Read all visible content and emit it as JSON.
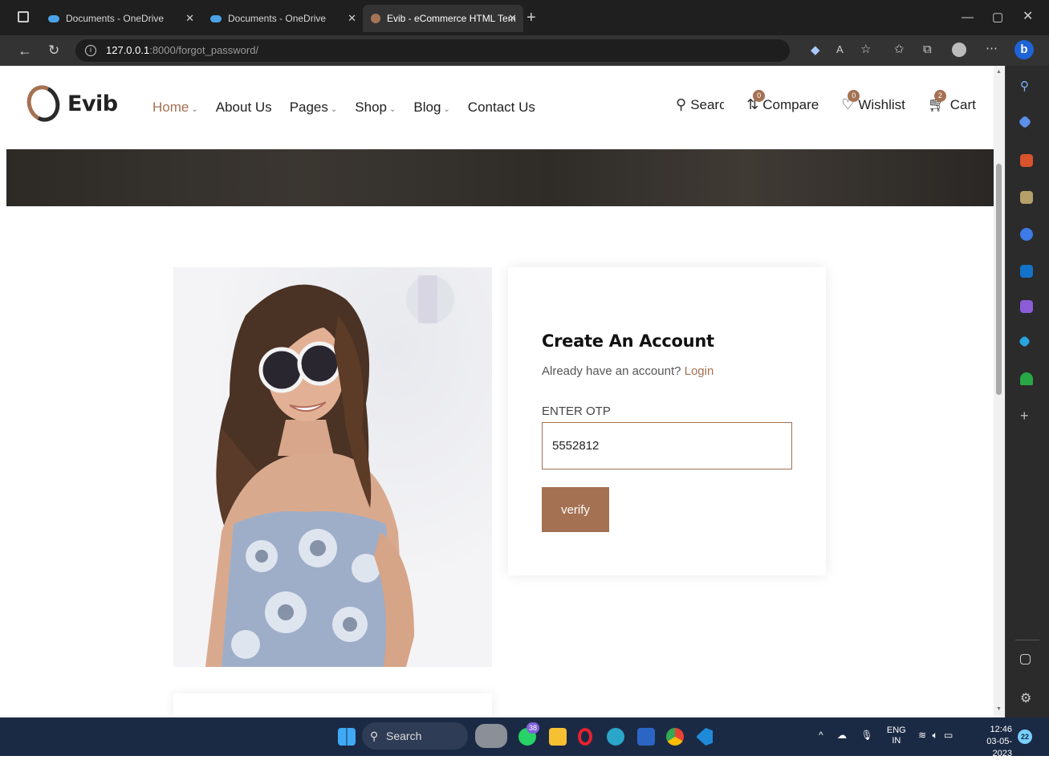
{
  "browser": {
    "tabs": [
      {
        "title": "Documents - OneDrive",
        "active": false
      },
      {
        "title": "Documents - OneDrive",
        "active": false
      },
      {
        "title": "Evib - eCommerce HTML Templa",
        "active": true
      }
    ],
    "url": {
      "host": "127.0.0.1",
      "rest": ":8000/forgot_password/"
    }
  },
  "site": {
    "logo_text": "Evib",
    "nav": [
      {
        "label": "Home",
        "dropdown": true,
        "active": true
      },
      {
        "label": "About Us",
        "dropdown": false,
        "active": false
      },
      {
        "label": "Pages",
        "dropdown": true,
        "active": false
      },
      {
        "label": "Shop",
        "dropdown": true,
        "active": false
      },
      {
        "label": "Blog",
        "dropdown": true,
        "active": false
      },
      {
        "label": "Contact Us",
        "dropdown": false,
        "active": false
      }
    ],
    "tools": {
      "search": "Search",
      "compare": {
        "label": "Compare",
        "count": "0"
      },
      "wishlist": {
        "label": "Wishlist",
        "count": "0"
      },
      "cart": {
        "label": "Cart",
        "count": "2"
      }
    },
    "accent_color": "#a47152"
  },
  "form": {
    "title": "Create An Account",
    "already_text": "Already have an account?",
    "login_link": "Login",
    "otp_label": "ENTER OTP",
    "otp_value": "5552812",
    "verify_label": "verify"
  },
  "taskbar": {
    "search": "Search",
    "whatsapp_badge": "38",
    "language": "ENG",
    "region": "IN",
    "time": "12:46",
    "date": "03-05-2023",
    "notifications": "22"
  }
}
